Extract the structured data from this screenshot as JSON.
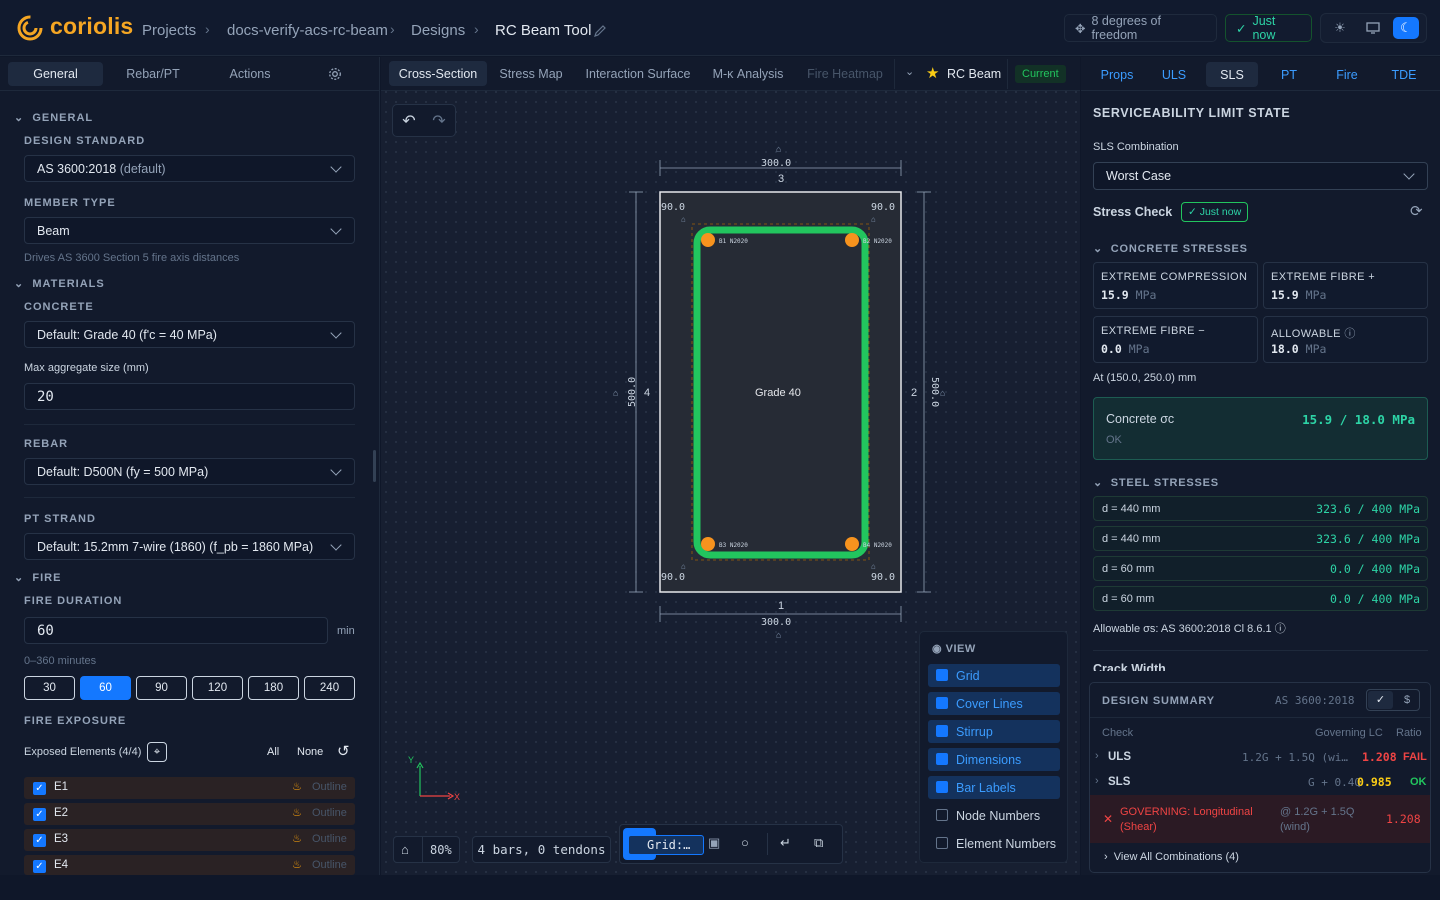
{
  "app": {
    "brand": "coriolis"
  },
  "breadcrumb": {
    "projects": "Projects",
    "project": "docs-verify-acs-rc-beam",
    "designs": "Designs",
    "current": "RC Beam Tool"
  },
  "topbar": {
    "dof": "8 degrees of freedom",
    "saved": "Just now"
  },
  "left": {
    "tabs": [
      "General",
      "Rebar/PT",
      "Actions"
    ],
    "general_section": "GENERAL",
    "design_standard_label": "DESIGN STANDARD",
    "design_standard_value": "AS 3600:2018",
    "design_standard_suffix": "(default)",
    "member_type_label": "MEMBER TYPE",
    "member_type_value": "Beam",
    "member_type_hint": "Drives AS 3600 Section 5 fire axis distances",
    "materials_section": "MATERIALS",
    "concrete_label": "CONCRETE",
    "concrete_value": "Default: Grade 40 (f'c = 40 MPa)",
    "agg_label": "Max aggregate size (mm)",
    "agg_value": "20",
    "rebar_label": "REBAR",
    "rebar_value": "Default: D500N (fy = 500 MPa)",
    "pt_label": "PT STRAND",
    "pt_value": "Default: 15.2mm 7-wire (1860) (f_pb = 1860 MPa)",
    "fire_section": "FIRE",
    "fire_duration_label": "FIRE DURATION",
    "fire_duration_value": "60",
    "fire_unit": "min",
    "fire_range": "0–360 minutes",
    "fire_buttons": [
      "30",
      "60",
      "90",
      "120",
      "180",
      "240"
    ],
    "fire_exposure_label": "FIRE EXPOSURE",
    "exposed_label": "Exposed Elements (4/4)",
    "all_label": "All",
    "none_label": "None",
    "elements": [
      {
        "name": "E1",
        "mode": "Outline"
      },
      {
        "name": "E2",
        "mode": "Outline"
      },
      {
        "name": "E3",
        "mode": "Outline"
      },
      {
        "name": "E4",
        "mode": "Outline"
      }
    ]
  },
  "center": {
    "tabs": [
      "Cross-Section",
      "Stress Map",
      "Interaction Surface",
      "M-κ Analysis",
      "Fire Heatmap"
    ],
    "design_name": "RC Beam",
    "status": "Current",
    "section": {
      "width": "300.0",
      "height": "500.0",
      "cover_tl": "90.0",
      "cover_tr": "90.0",
      "cover_bl": "90.0",
      "cover_br": "90.0",
      "face_top": "3",
      "face_right": "2",
      "face_bottom": "1",
      "face_left": "4",
      "material": "Grade 40",
      "bars": [
        "B1 N2020",
        "B2 N2020",
        "B3 N2020",
        "B4 N2020"
      ]
    },
    "axes": {
      "x": "X",
      "y": "Y"
    },
    "view": {
      "title": "VIEW",
      "items": [
        {
          "label": "Grid",
          "on": true
        },
        {
          "label": "Cover Lines",
          "on": true
        },
        {
          "label": "Stirrup",
          "on": true
        },
        {
          "label": "Dimensions",
          "on": true
        },
        {
          "label": "Bar Labels",
          "on": true
        },
        {
          "label": "Node Numbers",
          "on": false
        },
        {
          "label": "Element Numbers",
          "on": false
        }
      ]
    },
    "zoom": "80%",
    "summary": "4 bars, 0 tendons",
    "grid_select": "Grid:…"
  },
  "right": {
    "tabs": [
      "Props",
      "ULS",
      "SLS",
      "PT",
      "Fire",
      "TDE"
    ],
    "title": "SERVICEABILITY LIMIT STATE",
    "combo_label": "SLS Combination",
    "combo_value": "Worst Case",
    "stress_check": "Stress Check",
    "stress_badge": "Just now",
    "concrete_stresses": "CONCRETE STRESSES",
    "boxes": [
      {
        "title": "EXTREME COMPRESSION",
        "value": "15.9",
        "unit": "MPa"
      },
      {
        "title": "EXTREME FIBRE +",
        "value": "15.9",
        "unit": "MPa"
      },
      {
        "title": "EXTREME FIBRE −",
        "value": "0.0",
        "unit": "MPa"
      },
      {
        "title": "ALLOWABLE",
        "value": "18.0",
        "unit": "MPa"
      }
    ],
    "at_label": "At (150.0, 250.0) mm",
    "concrete_sigma_label": "Concrete σc",
    "concrete_sigma_value": "15.9 / 18.0 MPa",
    "concrete_ok": "OK",
    "steel_stresses": "STEEL STRESSES",
    "steel_rows": [
      {
        "d": "d = 440 mm",
        "v": "323.6 / 400 MPa"
      },
      {
        "d": "d = 440 mm",
        "v": "323.6 / 400 MPa"
      },
      {
        "d": "d = 60 mm",
        "v": "0.0 / 400 MPa"
      },
      {
        "d": "d = 60 mm",
        "v": "0.0 / 400 MPa"
      }
    ],
    "allowable_note": "Allowable σs: AS 3600:2018 Cl 8.6.1",
    "crack_width": "Crack Width"
  },
  "design_summary": {
    "title": "DESIGN SUMMARY",
    "standard": "AS 3600:2018",
    "cols": {
      "check": "Check",
      "lc": "Governing LC",
      "ratio": "Ratio"
    },
    "rows": [
      {
        "check": "ULS",
        "lc": "1.2G + 1.5Q (wi…",
        "ratio": "1.208",
        "status": "FAIL"
      },
      {
        "check": "SLS",
        "lc": "G + 0.4Q",
        "ratio": "0.985",
        "status": "OK"
      }
    ],
    "governing": "GOVERNING: Longitudinal (Shear)",
    "governing_lc": "@ 1.2G + 1.5Q (wind)",
    "governing_ratio": "1.208",
    "view_all": "View All Combinations (4)"
  },
  "colors": {
    "accent": "#1478ff",
    "ok": "#2dd4a6",
    "fail": "#ef4444",
    "stirrup": "#22c55e",
    "bar": "#f7931e"
  }
}
